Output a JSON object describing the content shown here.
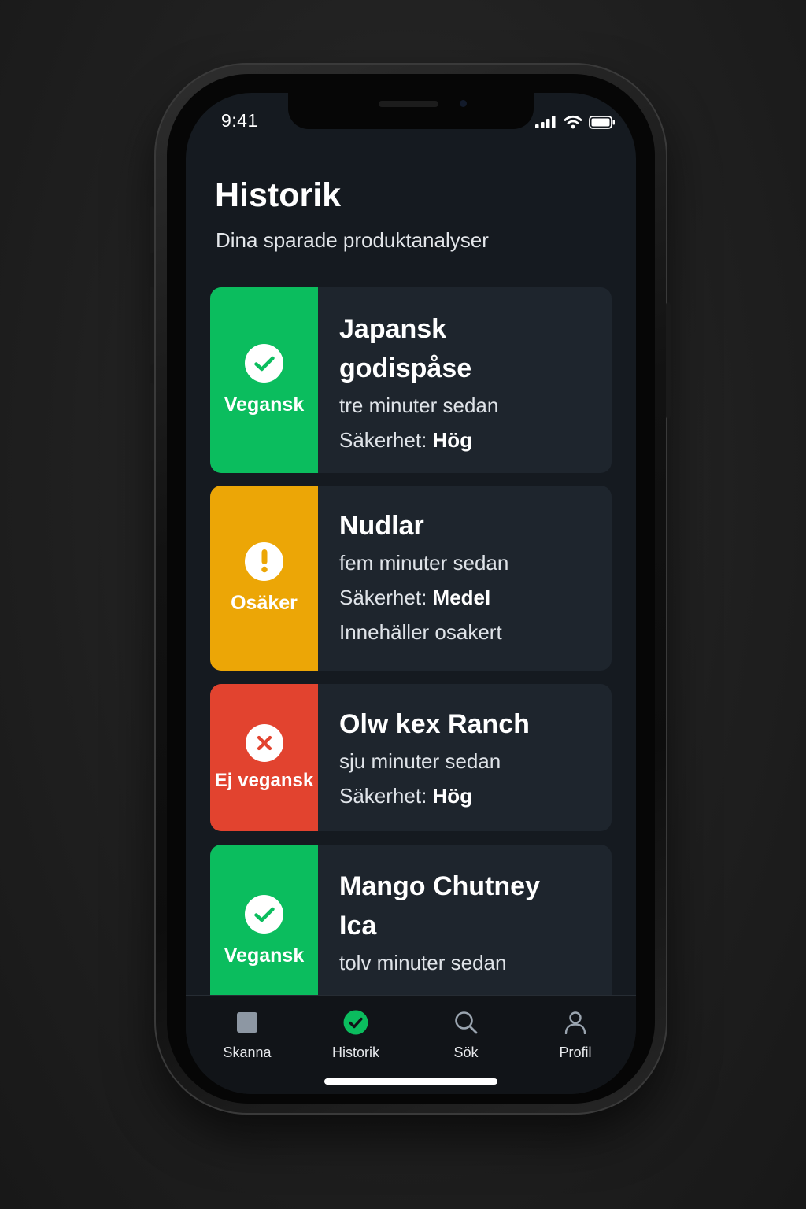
{
  "status_bar": {
    "time": "9:41"
  },
  "header": {
    "title": "Historik",
    "subtitle": "Dina sparade produktanalyser"
  },
  "colors": {
    "vegan": "#0bbd5e",
    "uncertain": "#eca606",
    "not_vegan": "#e2432f",
    "background": "#151a20",
    "card": "#1e252d"
  },
  "history": [
    {
      "status": "vegan",
      "status_icon": "check-icon",
      "badge_label": "Vegansk",
      "title_line1": "Japansk",
      "title_line2": "godispåse",
      "time": "tre minuter sedan",
      "confidence_label": "Säkerhet:",
      "confidence_value": "Hög"
    },
    {
      "status": "uncertain",
      "status_icon": "exclamation-icon",
      "badge_label": "Osäker",
      "title": "Nudlar",
      "time": "fem minuter sedan",
      "confidence_label": "Säkerhet:",
      "confidence_value": "Medel",
      "note": "Innehäller osakert"
    },
    {
      "status": "not_vegan",
      "status_icon": "cross-icon",
      "badge_label": "Ej vegansk",
      "title": "Olw kex Ranch",
      "time": "sju minuter sedan",
      "confidence_label": "Säkerhet:",
      "confidence_value": "Hög"
    },
    {
      "status": "vegan",
      "status_icon": "check-icon",
      "badge_label": "Vegansk",
      "title_line1": "Mango Chutney",
      "title_line2": "Ica",
      "time": "tolv minuter sedan"
    }
  ],
  "tabbar": {
    "active": "Historik",
    "items": [
      {
        "label": "Skanna",
        "icon": "scan-square-icon"
      },
      {
        "label": "Historik",
        "icon": "check-circle-icon"
      },
      {
        "label": "Sök",
        "icon": "search-icon"
      },
      {
        "label": "Profil",
        "icon": "user-icon"
      }
    ]
  }
}
